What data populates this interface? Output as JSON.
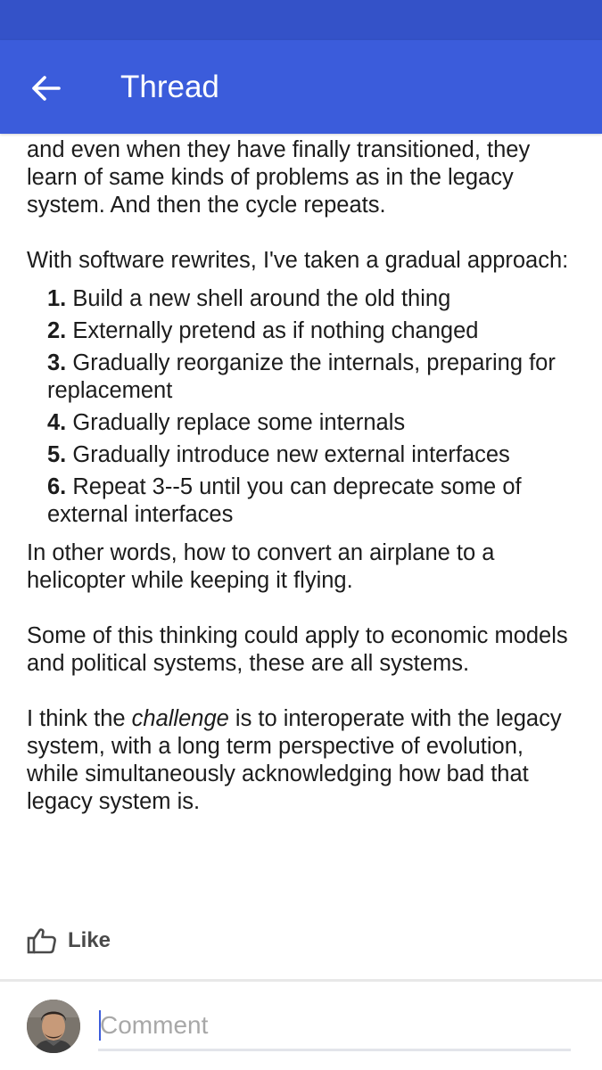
{
  "app_bar": {
    "title": "Thread",
    "back_icon": "arrow-left-icon"
  },
  "post": {
    "intro_partial": "and even when they have finally transitioned, they learn of same kinds of problems as in the legacy system. And then the cycle repeats.",
    "rewrite_intro": "With software rewrites, I've taken a gradual approach:",
    "steps": [
      {
        "num": "1.",
        "text": "Build a new shell around the old thing"
      },
      {
        "num": "2.",
        "text": "Externally pretend as if nothing changed"
      },
      {
        "num": "3.",
        "text": "Gradually reorganize the internals, preparing for replacement"
      },
      {
        "num": "4.",
        "text": "Gradually replace some internals"
      },
      {
        "num": "5.",
        "text": "Gradually introduce new external interfaces"
      },
      {
        "num": "6.",
        "text": "Repeat 3--5 until you can deprecate some of external interfaces"
      }
    ],
    "airplane": "In other words, how to convert an airplane to a helicopter while keeping it flying.",
    "economic": "Some of this thinking could apply to economic models and political systems, these are all systems.",
    "closing": {
      "before": "I think the ",
      "emphasis": "challenge",
      "after": " is to interoperate with the legacy system, with a long term perspective of evolution, while simultaneously acknowledging how bad that legacy system is."
    }
  },
  "actions": {
    "like_label": "Like",
    "like_icon": "thumbs-up-icon"
  },
  "comment": {
    "placeholder": "Comment",
    "value": ""
  },
  "colors": {
    "status_bar": "#3452c8",
    "app_bar": "#3b5cdb",
    "text": "#1c1c1c"
  }
}
